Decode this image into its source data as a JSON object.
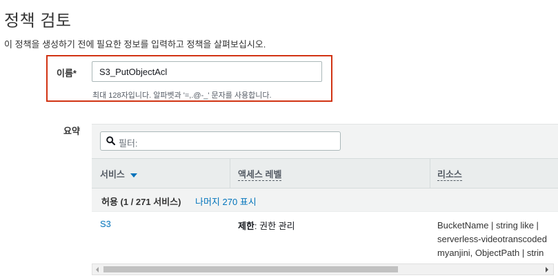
{
  "header": {
    "title": "정책 검토",
    "subtitle": "이 정책을 생성하기 전에 필요한 정보를 입력하고 정책을 살펴보십시오."
  },
  "name_field": {
    "label": "이름*",
    "value": "S3_PutObjectAcl",
    "hint": "최대 128자입니다. 알파벳과 '=,.@-_' 문자를 사용합니다."
  },
  "summary": {
    "label": "요약",
    "filter_placeholder": "필터:",
    "columns": [
      "서비스",
      "액세스 레벨",
      "리소스"
    ],
    "group": {
      "text": "허용 (1 / 271 서비스)",
      "link": "나머지 270 표시"
    },
    "rows": [
      {
        "service": "S3",
        "access_bold": "제한",
        "access_rest": ": 권한 관리",
        "resource_lines": [
          "BucketName | string like |",
          "serverless-videotranscoded",
          "myanjini, ObjectPath | strin"
        ]
      }
    ]
  },
  "colors": {
    "error_border": "#d13212",
    "link": "#0073bb",
    "header_bg": "#eaeded"
  },
  "icons": {
    "search": "search-icon",
    "sort": "caret-down-icon"
  }
}
